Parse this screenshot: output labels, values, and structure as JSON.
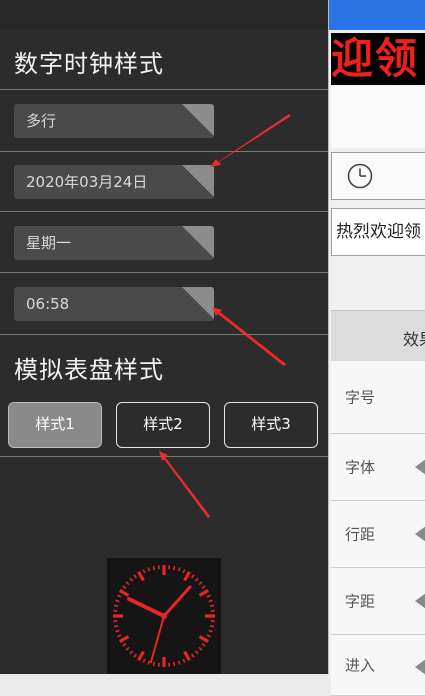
{
  "digital_clock": {
    "title": "数字时钟样式",
    "combos": [
      {
        "value": "多行"
      },
      {
        "value": "2020年03月24日"
      },
      {
        "value": "星期一"
      },
      {
        "value": "06:58"
      }
    ]
  },
  "analog_clock": {
    "title": "模拟表盘样式",
    "styles": [
      {
        "label": "样式1",
        "selected": true
      },
      {
        "label": "样式2",
        "selected": false
      },
      {
        "label": "样式3",
        "selected": false
      }
    ],
    "preview_icon": "analog-clock-face-icon"
  },
  "right_panel": {
    "led_text": "迎领",
    "text_content": "热烈欢迎领",
    "effects_header": "效果",
    "properties": [
      {
        "label": "字号",
        "has_arrow": false
      },
      {
        "label": "字体",
        "has_arrow": true
      },
      {
        "label": "行距",
        "has_arrow": true
      },
      {
        "label": "字距",
        "has_arrow": true
      },
      {
        "label": "进入",
        "has_arrow": true
      }
    ]
  },
  "colors": {
    "panel_bg": "#2c2c2c",
    "accent_blue": "#2b74e6",
    "led_red": "#ee1f1f",
    "annotation_arrow": "#ee2a2a"
  }
}
